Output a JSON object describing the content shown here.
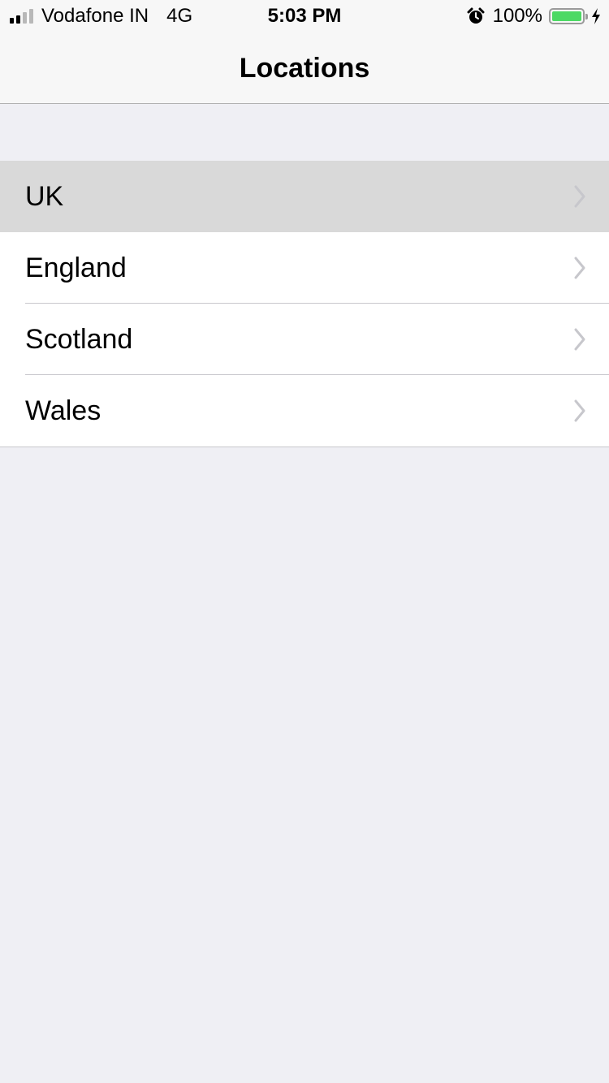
{
  "status_bar": {
    "carrier": "Vodafone IN",
    "network": "4G",
    "time": "5:03 PM",
    "battery_percent": "100%",
    "battery_level": 1.0,
    "signal_bars_active": 2,
    "signal_bars_total": 4,
    "icons": [
      "signal-icon",
      "alarm-icon",
      "battery-icon",
      "charging-bolt-icon"
    ]
  },
  "nav": {
    "title": "Locations"
  },
  "locations": {
    "items": [
      {
        "label": "UK",
        "highlighted": true
      },
      {
        "label": "England",
        "highlighted": false
      },
      {
        "label": "Scotland",
        "highlighted": false
      },
      {
        "label": "Wales",
        "highlighted": false
      }
    ]
  },
  "colors": {
    "background": "#efeff4",
    "nav_background": "#f7f7f7",
    "highlight": "#d9d9d9",
    "battery_green": "#4cd964",
    "chevron": "#c7c7cc"
  }
}
